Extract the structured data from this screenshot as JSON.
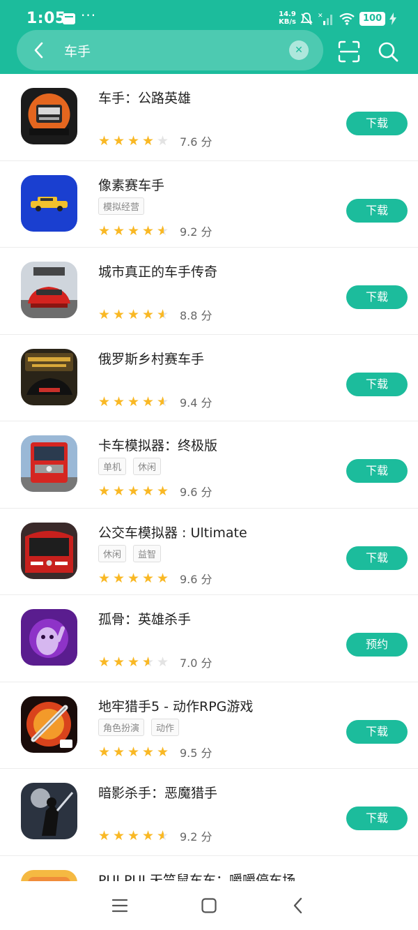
{
  "status_bar": {
    "time": "1:05",
    "more": "···",
    "net_speed_value": "14.9",
    "net_speed_unit": "KB/s",
    "battery": "100"
  },
  "search": {
    "query": "车手"
  },
  "accent_color": "#1cbc9c",
  "star_color": "#f9b824",
  "apps": [
    {
      "name": "车手：公路英雄",
      "tags": [],
      "rating": 7.6,
      "score": "7.6 分",
      "button": "下载"
    },
    {
      "name": "像素赛车手",
      "tags": [
        "模拟经营"
      ],
      "rating": 9.2,
      "score": "9.2 分",
      "button": "下载"
    },
    {
      "name": "城市真正的车手传奇",
      "tags": [],
      "rating": 8.8,
      "score": "8.8 分",
      "button": "下载"
    },
    {
      "name": "俄罗斯乡村赛车手",
      "tags": [],
      "rating": 9.4,
      "score": "9.4 分",
      "button": "下载"
    },
    {
      "name": "卡车模拟器：终极版",
      "tags": [
        "单机",
        "休闲"
      ],
      "rating": 9.6,
      "score": "9.6 分",
      "button": "下载"
    },
    {
      "name": "公交车模拟器 : Ultimate",
      "tags": [
        "休闲",
        "益智"
      ],
      "rating": 9.6,
      "score": "9.6 分",
      "button": "下载"
    },
    {
      "name": "孤骨：英雄杀手",
      "tags": [],
      "rating": 7.0,
      "score": "7.0 分",
      "button": "预约"
    },
    {
      "name": "地牢猎手5 - 动作RPG游戏",
      "tags": [
        "角色扮演",
        "动作"
      ],
      "rating": 9.5,
      "score": "9.5 分",
      "button": "下载"
    },
    {
      "name": "暗影杀手：恶魔猎手",
      "tags": [],
      "rating": 9.2,
      "score": "9.2 分",
      "button": "下载"
    },
    {
      "name": "PUI PUI 天竺鼠车车：嚼嚼停车场",
      "tags": [],
      "rating": null,
      "score": "",
      "button": ""
    }
  ]
}
